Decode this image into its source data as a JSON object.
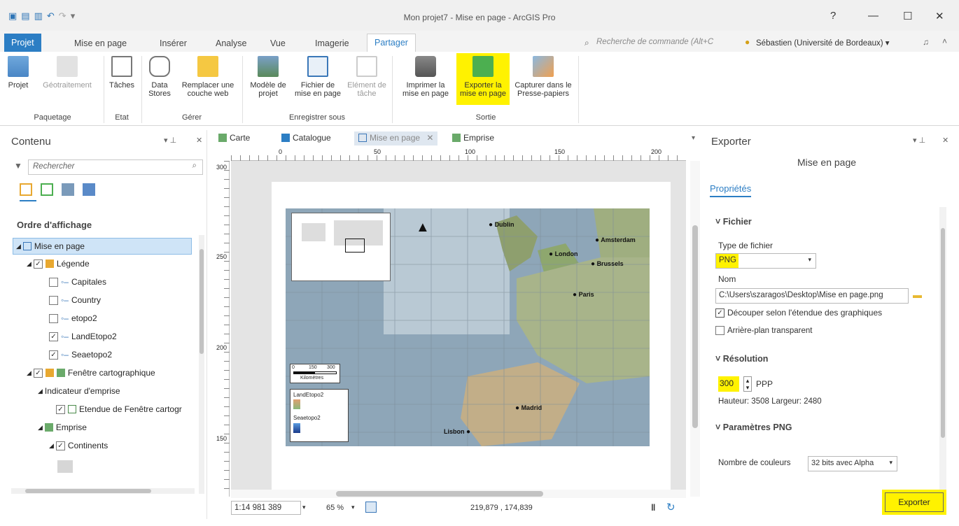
{
  "window": {
    "title": "Mon projet7 - Mise en page - ArcGIS Pro",
    "help": "?",
    "minimize": "—",
    "maximize": "☐",
    "close": "✕"
  },
  "ribbon_tabs": [
    "Projet",
    "Mise en page",
    "Insérer",
    "Analyse",
    "Vue",
    "Imagerie",
    "Partager"
  ],
  "command_search": "Recherche de commande (Alt+C",
  "user": "Sébastien (Université de Bordeaux) ▾",
  "ribbon": {
    "btn_projet": "Projet",
    "btn_geotraitement": "Géotraitement",
    "btn_taches": "Tâches",
    "btn_datastores": "Data Stores",
    "btn_remplacer": "Remplacer une couche web",
    "btn_modele": "Modèle de projet",
    "btn_fichier": "Fichier de mise en page",
    "btn_element": "Elément de tâche",
    "btn_imprimer": "Imprimer la mise en page",
    "btn_exporter": "Exporter la mise en page",
    "btn_capturer": "Capturer dans le Presse-papiers",
    "grp_paquetage": "Paquetage",
    "grp_etat": "Etat",
    "grp_gerer": "Gérer",
    "grp_enregistrer": "Enregistrer sous",
    "grp_sortie": "Sortie"
  },
  "contents": {
    "title": "Contenu",
    "search_placeholder": "Rechercher",
    "heading": "Ordre d'affichage",
    "items": [
      {
        "label": "Mise en page"
      },
      {
        "label": "Légende"
      },
      {
        "label": "Capitales"
      },
      {
        "label": "Country"
      },
      {
        "label": "etopo2"
      },
      {
        "label": "LandEtopo2"
      },
      {
        "label": "Seaetopo2"
      },
      {
        "label": "Fenêtre cartographique"
      },
      {
        "label": "Indicateur d'emprise"
      },
      {
        "label": "Etendue de Fenêtre cartogr"
      },
      {
        "label": "Emprise"
      },
      {
        "label": "Continents"
      }
    ]
  },
  "view_tabs": [
    "Carte",
    "Catalogue",
    "Mise en page",
    "Emprise"
  ],
  "ruler_h": [
    "0",
    "50",
    "100",
    "150",
    "200"
  ],
  "ruler_v": [
    "300",
    "250",
    "200",
    "150"
  ],
  "map": {
    "cities": [
      "Dublin",
      "London",
      "Amsterdam",
      "Brussels",
      "Paris",
      "Madrid",
      "Lisbon"
    ],
    "scale_labels": [
      "0",
      "150",
      "300"
    ],
    "scale_unit": "Kilomètres",
    "legend": [
      "LandEtopo2",
      "Seaetopo2"
    ]
  },
  "status": {
    "scale": "1:14 981 389",
    "zoom": "65 %",
    "coords": "219,879 , 174,839"
  },
  "export": {
    "title": "Exporter",
    "subtitle": "Mise en page",
    "tab": "Propriétés",
    "section_file": "Fichier",
    "filetype_label": "Type de fichier",
    "filetype_value": "PNG",
    "name_label": "Nom",
    "name_value": "C:\\Users\\szaragos\\Desktop\\Mise en page.png",
    "clip_label": "Découper selon l'étendue des graphiques",
    "clip_checked": true,
    "transparent_label": "Arrière-plan transparent",
    "section_resolution": "Résolution",
    "resolution_value": "300",
    "resolution_unit": "PPP",
    "dimensions": "Hauteur: 3508 Largeur: 2480",
    "section_png": "Paramètres PNG",
    "colors_label": "Nombre de couleurs",
    "colors_value": "32 bits avec Alpha",
    "export_button": "Exporter"
  }
}
